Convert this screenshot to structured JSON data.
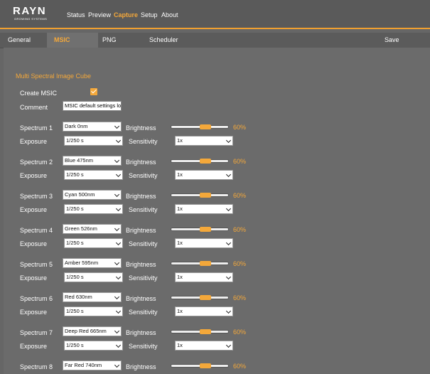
{
  "brand": {
    "name": "RAYN",
    "tagline": "GROWING SYSTEMS"
  },
  "nav": [
    "Status",
    "Preview",
    "Capture",
    "Setup",
    "About"
  ],
  "nav_active": "Capture",
  "tabs": [
    "General",
    "MSIC",
    "PNG",
    "Scheduler"
  ],
  "tab_active": "MSIC",
  "save_label": "Save",
  "section_title": "Multi Spectral Image Cube",
  "create_msic": {
    "label": "Create MSIC",
    "checked": true
  },
  "comment": {
    "label": "Comment",
    "value": "MSIC default settings lo"
  },
  "field_labels": {
    "exposure": "Exposure",
    "brightness": "Brightness",
    "sensitivity": "Sensitivity"
  },
  "spectra": [
    {
      "label": "Spectrum 1",
      "band": "Dark 0nm",
      "brightness": "60%",
      "brightness_value": 0.6,
      "exposure": "1/250 s",
      "sensitivity": "1x"
    },
    {
      "label": "Spectrum 2",
      "band": "Blue 475nm",
      "brightness": "60%",
      "brightness_value": 0.6,
      "exposure": "1/250 s",
      "sensitivity": "1x"
    },
    {
      "label": "Spectrum 3",
      "band": "Cyan 500nm",
      "brightness": "60%",
      "brightness_value": 0.6,
      "exposure": "1/250 s",
      "sensitivity": "1x"
    },
    {
      "label": "Spectrum 4",
      "band": "Green 526nm",
      "brightness": "60%",
      "brightness_value": 0.6,
      "exposure": "1/250 s",
      "sensitivity": "1x"
    },
    {
      "label": "Spectrum 5",
      "band": "Amber 595nm",
      "brightness": "60%",
      "brightness_value": 0.6,
      "exposure": "1/250 s",
      "sensitivity": "1x"
    },
    {
      "label": "Spectrum 6",
      "band": "Red 630nm",
      "brightness": "60%",
      "brightness_value": 0.6,
      "exposure": "1/250 s",
      "sensitivity": "1x"
    },
    {
      "label": "Spectrum 7",
      "band": "Deep Red 665nm",
      "brightness": "60%",
      "brightness_value": 0.6,
      "exposure": "1/250 s",
      "sensitivity": "1x"
    },
    {
      "label": "Spectrum 8",
      "band": "Far Red 740nm",
      "brightness": "60%",
      "brightness_value": 0.6
    }
  ],
  "colors": {
    "accent": "#f4a83a",
    "background": "#666666",
    "header": "#5a5a5a"
  },
  "icons": {
    "checkbox": "checkmark-icon",
    "dropdown": "chevron-down-icon"
  }
}
